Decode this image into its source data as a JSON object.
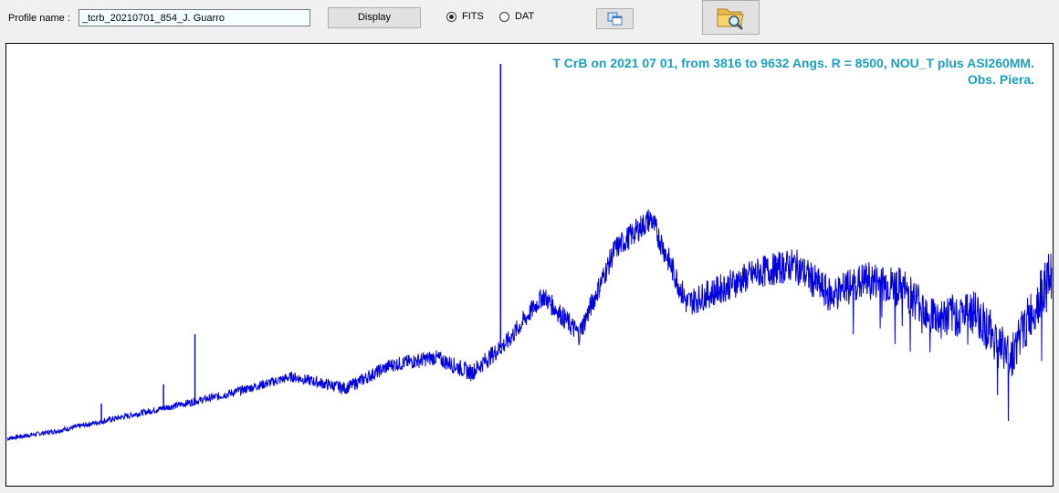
{
  "toolbar": {
    "profile_label": "Profile name :",
    "profile_value": "_tcrb_20210701_854_J. Guarro",
    "display_label": "Display",
    "radio_fits": "FITS",
    "radio_dat": "DAT",
    "selected_format": "FITS",
    "copy_icon": "copy-windows-icon",
    "open_icon": "folder-search-icon"
  },
  "plot": {
    "caption_line1": "T CrB on 2021 07 01,  from 3816 to 9632 Angs.  R = 8500, NOU_T plus ASI260MM.",
    "caption_line2": "Obs. Piera.",
    "line_color": "#0000dd",
    "caption_color": "#1a9fbf"
  },
  "chart_data": {
    "type": "line",
    "xlim": [
      3816,
      9632
    ],
    "grid": false,
    "series": [
      {
        "x": [
          3816,
          4100,
          4500,
          5000,
          5400,
          5700,
          5950,
          6200,
          6400,
          6600,
          6800,
          7000,
          7200,
          7400,
          7600,
          7800,
          8000,
          8200,
          8400,
          8600,
          8800,
          9000,
          9200,
          9400,
          9632
        ],
        "y": [
          0.03,
          0.05,
          0.09,
          0.14,
          0.19,
          0.16,
          0.22,
          0.24,
          0.2,
          0.28,
          0.4,
          0.3,
          0.52,
          0.6,
          0.38,
          0.42,
          0.46,
          0.48,
          0.4,
          0.44,
          0.42,
          0.34,
          0.36,
          0.24,
          0.46
        ]
      }
    ],
    "peaks": [
      {
        "x": 6563,
        "y": 1.0
      },
      {
        "x": 4861,
        "y": 0.3
      },
      {
        "x": 4686,
        "y": 0.17
      },
      {
        "x": 4340,
        "y": 0.12
      }
    ]
  }
}
